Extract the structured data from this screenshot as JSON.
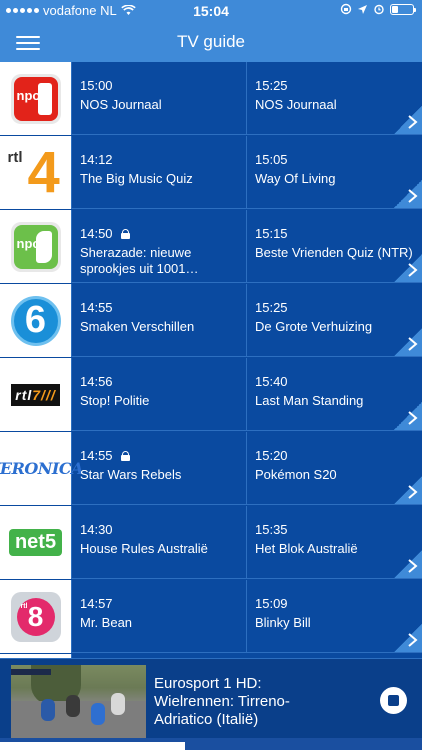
{
  "status": {
    "carrier": "vodafone NL",
    "time": "15:04"
  },
  "nav": {
    "title": "TV guide"
  },
  "guide": {
    "rows": [
      {
        "channel": "NPO 1",
        "now_time": "15:00",
        "now_title": "NOS Journaal",
        "now_locked": false,
        "next_time": "15:25",
        "next_title": "NOS Journaal"
      },
      {
        "channel": "RTL 4",
        "now_time": "14:12",
        "now_title": "The Big Music Quiz",
        "now_locked": false,
        "next_time": "15:05",
        "next_title": "Way Of Living"
      },
      {
        "channel": "NPO 3",
        "now_time": "14:50",
        "now_title": "Sherazade: nieuwe sprookjes uit 1001…",
        "now_locked": true,
        "next_time": "15:15",
        "next_title": "Beste Vrienden Quiz (NTR)"
      },
      {
        "channel": "SBS6",
        "now_time": "14:55",
        "now_title": "Smaken Verschillen",
        "now_locked": false,
        "next_time": "15:25",
        "next_title": "De Grote Verhuizing"
      },
      {
        "channel": "RTL 7",
        "now_time": "14:56",
        "now_title": "Stop! Politie",
        "now_locked": false,
        "next_time": "15:40",
        "next_title": "Last Man Standing"
      },
      {
        "channel": "Veronica",
        "now_time": "14:55",
        "now_title": "Star Wars Rebels",
        "now_locked": true,
        "next_time": "15:20",
        "next_title": "Pokémon S20"
      },
      {
        "channel": "NET5",
        "now_time": "14:30",
        "now_title": "House Rules Australië",
        "now_locked": false,
        "next_time": "15:35",
        "next_title": "Het Blok Australië"
      },
      {
        "channel": "RTL 8",
        "now_time": "14:57",
        "now_title": "Mr. Bean",
        "now_locked": false,
        "next_time": "15:09",
        "next_title": "Blinky Bill"
      }
    ]
  },
  "logos": {
    "rtl": "rtl",
    "four": "4",
    "npo_o": "npo",
    "six": "6",
    "rtl7": "rtl",
    "rtl7_num": "7///",
    "veronica": "VERONICA",
    "net5": "net5",
    "rtl8_small": "rtl",
    "rtl8_num": "8"
  },
  "player": {
    "line1": "Eurosport 1 HD:",
    "line2": "Wielrennen: Tirreno-",
    "line3": "Adriatico (Italië)"
  },
  "colors": {
    "background": "#0a4aa0",
    "bar": "#3f8ad8",
    "corner": "#3f8ad8"
  }
}
